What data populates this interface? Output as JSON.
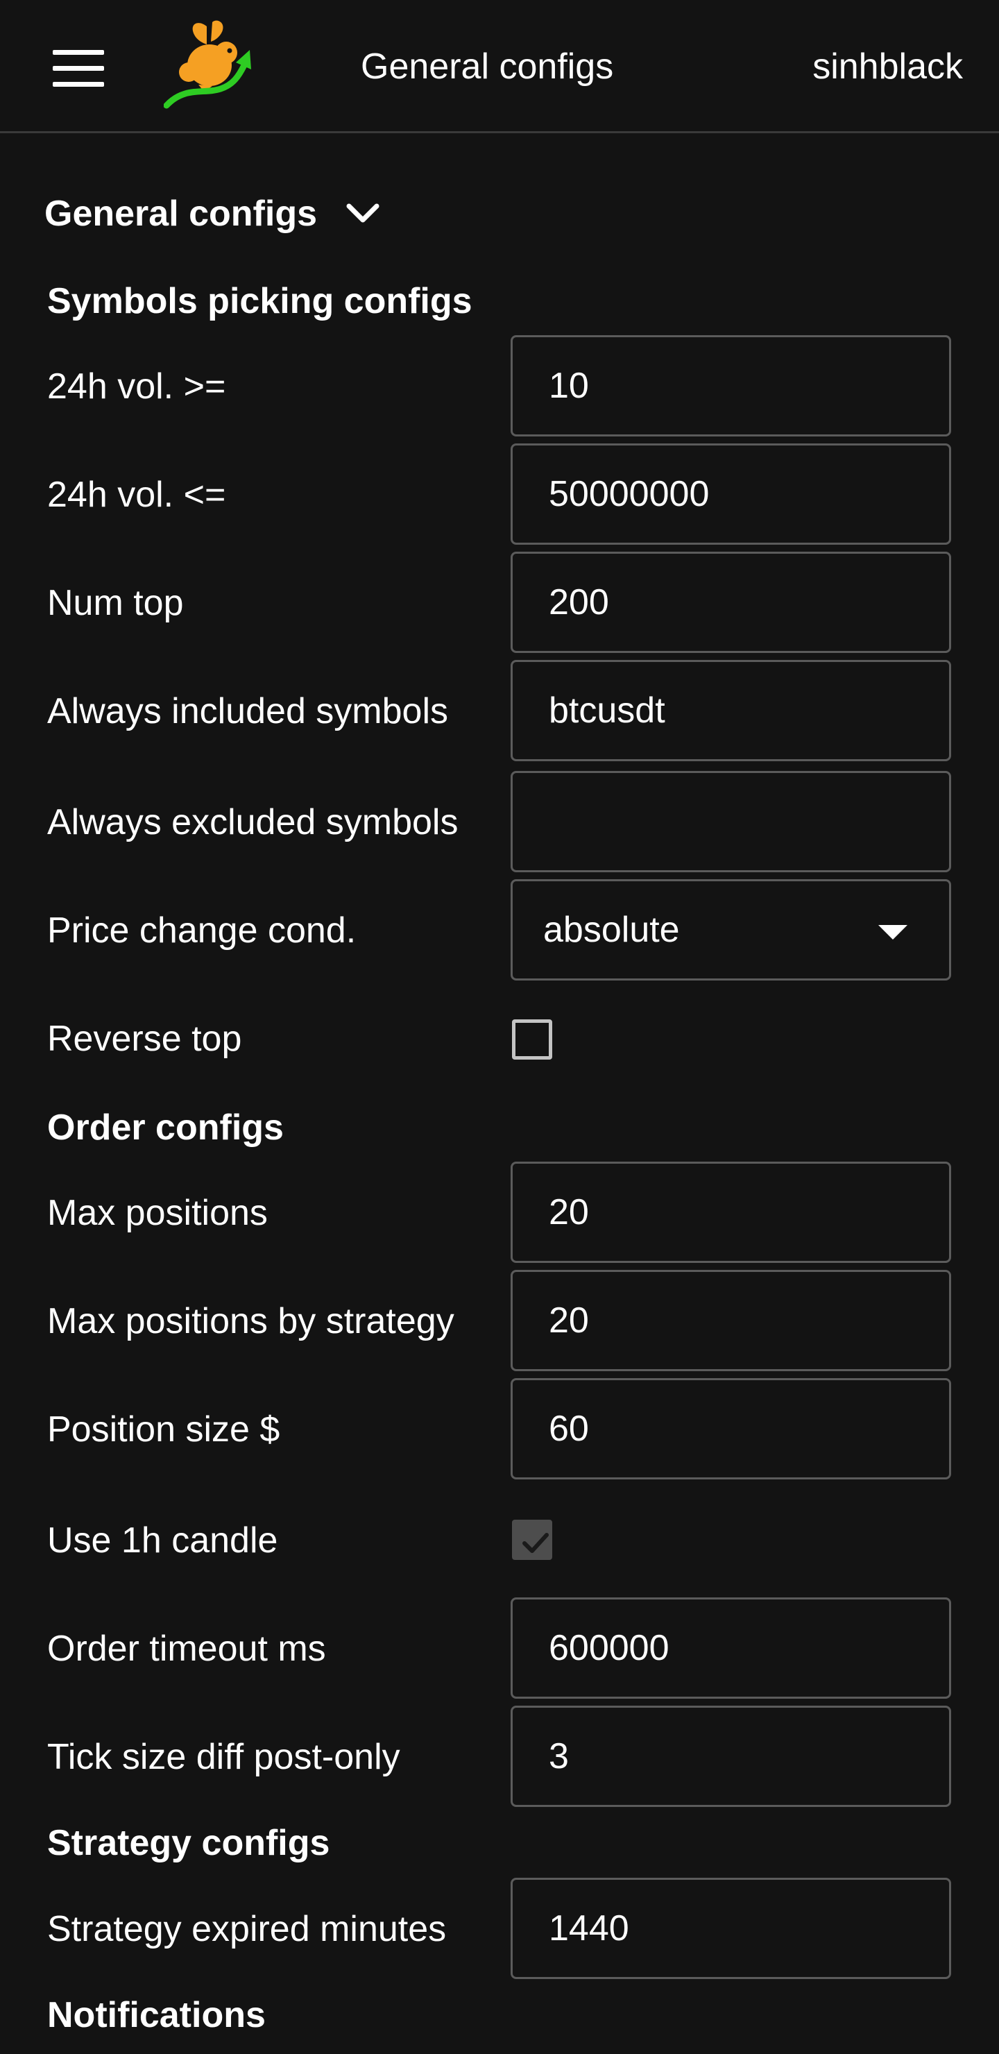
{
  "topbar": {
    "title": "General configs",
    "username": "sinhblack"
  },
  "section": {
    "title": "General configs"
  },
  "groups": {
    "symbols": "Symbols picking configs",
    "order": "Order configs",
    "strategy": "Strategy configs",
    "notifications": "Notifications"
  },
  "fields": {
    "vol_min": {
      "label": "24h vol. >=",
      "value": "10"
    },
    "vol_max": {
      "label": "24h vol. <=",
      "value": "50000000"
    },
    "num_top": {
      "label": "Num top",
      "value": "200"
    },
    "always_included": {
      "label": "Always included symbols",
      "value": "btcusdt"
    },
    "always_excluded": {
      "label": "Always excluded symbols",
      "value": ""
    },
    "price_change": {
      "label": "Price change cond.",
      "value": "absolute"
    },
    "reverse_top": {
      "label": "Reverse top",
      "checked": false
    },
    "max_positions": {
      "label": "Max positions",
      "value": "20"
    },
    "max_positions_strategy": {
      "label": "Max positions by strategy",
      "value": "20"
    },
    "position_size": {
      "label": "Position size $",
      "value": "60"
    },
    "use_1h_candle": {
      "label": "Use 1h candle",
      "checked": true
    },
    "order_timeout": {
      "label": "Order timeout ms",
      "value": "600000"
    },
    "tick_size_diff": {
      "label": "Tick size diff post-only",
      "value": "3"
    },
    "strategy_expired": {
      "label": "Strategy expired minutes",
      "value": "1440"
    }
  },
  "icons": {
    "menu": "hamburger-menu-icon",
    "logo": "rabbit-logo-icon",
    "toggle": "chevron-down-icon",
    "dropdown": "caret-down-icon",
    "check": "checkmark-icon"
  },
  "colors": {
    "background": "#131313",
    "text": "#ffffff",
    "border": "#5b5b5b",
    "logo_orange": "#f5a023",
    "logo_green": "#2ecc23"
  }
}
